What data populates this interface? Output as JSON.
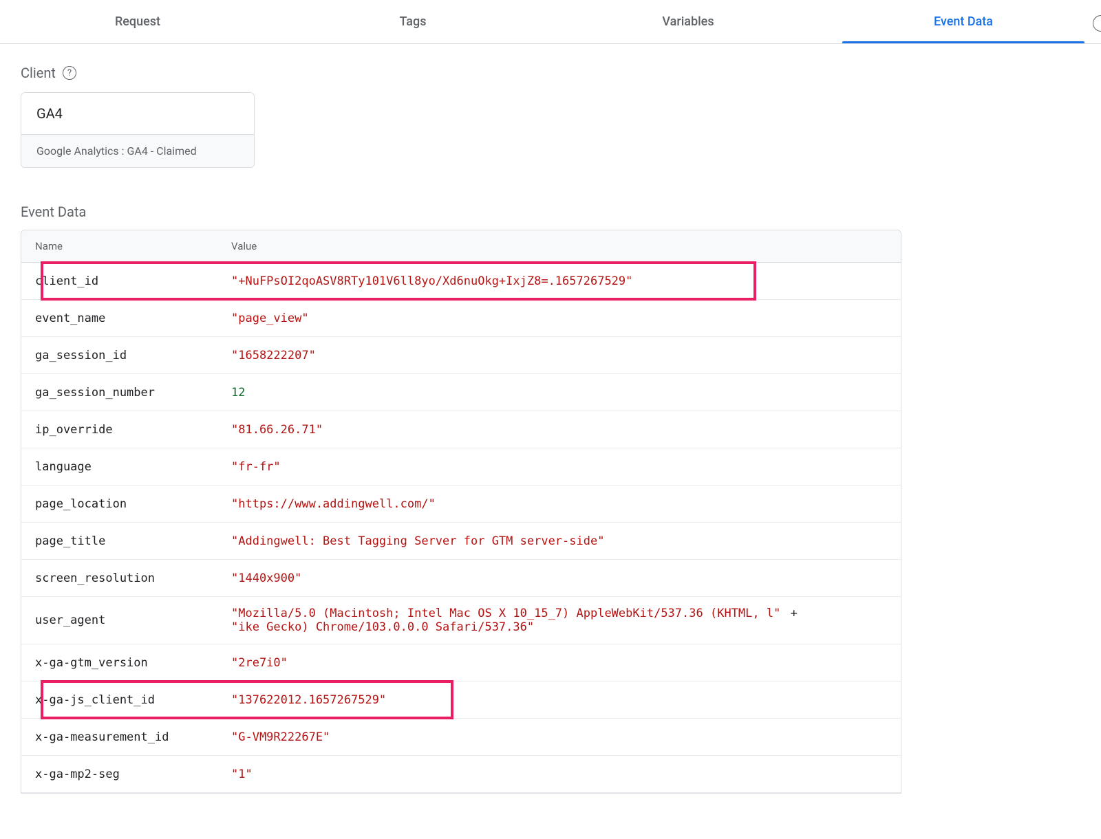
{
  "tabs": [
    {
      "label": "Request",
      "active": false
    },
    {
      "label": "Tags",
      "active": false
    },
    {
      "label": "Variables",
      "active": false
    },
    {
      "label": "Event Data",
      "active": true
    }
  ],
  "client": {
    "section_label": "Client",
    "name": "GA4",
    "subtitle": "Google Analytics : GA4 - Claimed"
  },
  "event_data": {
    "section_label": "Event Data",
    "columns": {
      "name": "Name",
      "value": "Value"
    },
    "rows": [
      {
        "name": "client_id",
        "value": "\"+NuFPsOI2qoASV8RTy101V6ll8yo/Xd6nuOkg+IxjZ8=.1657267529\"",
        "type": "string",
        "highlight": "wide"
      },
      {
        "name": "event_name",
        "value": "\"page_view\"",
        "type": "string"
      },
      {
        "name": "ga_session_id",
        "value": "\"1658222207\"",
        "type": "string"
      },
      {
        "name": "ga_session_number",
        "value": "12",
        "type": "number"
      },
      {
        "name": "ip_override",
        "value": "\"81.66.26.71\"",
        "type": "string"
      },
      {
        "name": "language",
        "value": "\"fr-fr\"",
        "type": "string"
      },
      {
        "name": "page_location",
        "value": "\"https://www.addingwell.com/\"",
        "type": "string"
      },
      {
        "name": "page_title",
        "value": "\"Addingwell: Best Tagging Server for GTM server-side\"",
        "type": "string"
      },
      {
        "name": "screen_resolution",
        "value": "\"1440x900\"",
        "type": "string"
      },
      {
        "name": "user_agent",
        "value_parts": [
          "\"Mozilla/5.0 (Macintosh; Intel Mac OS X 10_15_7) AppleWebKit/537.36 (KHTML, l\"",
          "\"ike Gecko) Chrome/103.0.0.0 Safari/537.36\""
        ],
        "type": "concat"
      },
      {
        "name": "x-ga-gtm_version",
        "value": "\"2re7i0\"",
        "type": "string"
      },
      {
        "name": "x-ga-js_client_id",
        "value": "\"137622012.1657267529\"",
        "type": "string",
        "highlight": "narrow"
      },
      {
        "name": "x-ga-measurement_id",
        "value": "\"G-VM9R22267E\"",
        "type": "string"
      },
      {
        "name": "x-ga-mp2-seg",
        "value": "\"1\"",
        "type": "string"
      }
    ]
  }
}
